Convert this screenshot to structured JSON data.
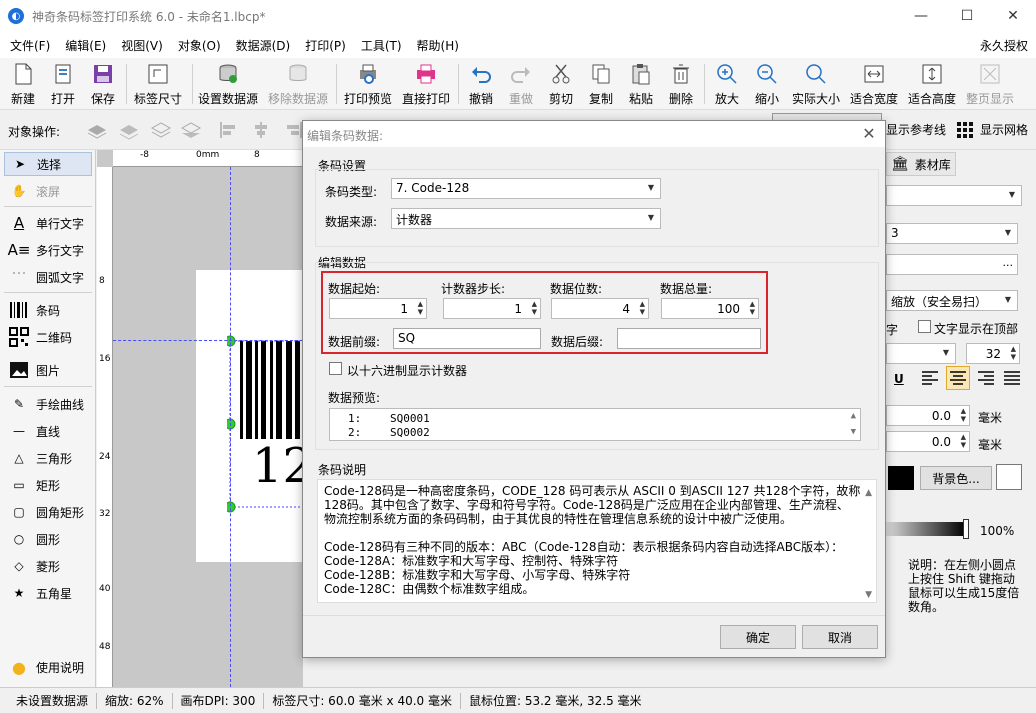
{
  "window": {
    "title": "神奇条码标签打印系统 6.0 - 未命名1.lbcp*"
  },
  "menu": {
    "items": [
      "文件(F)",
      "编辑(E)",
      "视图(V)",
      "对象(O)",
      "数据源(D)",
      "打印(P)",
      "工具(T)",
      "帮助(H)"
    ],
    "right": "永久授权"
  },
  "toolbar": {
    "new": "新建",
    "open": "打开",
    "save": "保存",
    "label_size": "标签尺寸",
    "set_datasource": "设置数据源",
    "remove_datasource": "移除数据源",
    "print_preview": "打印预览",
    "direct_print": "直接打印",
    "undo": "撤销",
    "redo": "重做",
    "cut": "剪切",
    "copy": "复制",
    "paste": "粘贴",
    "delete": "删除",
    "zoom_in": "放大",
    "zoom_out": "缩小",
    "actual_size": "实际大小",
    "fit_width": "适合宽度",
    "fit_height": "适合高度",
    "full_page": "整页显示"
  },
  "objbar": {
    "label": "对象操作:",
    "show_guides": "显示参考线",
    "show_grid": "显示网格"
  },
  "leftpanel": {
    "select": "选择",
    "scroll": "滚屏",
    "single_text": "单行文字",
    "multi_text": "多行文字",
    "arc_text": "圆弧文字",
    "barcode": "条码",
    "qrcode": "二维码",
    "image": "图片",
    "freehand": "手绘曲线",
    "line": "直线",
    "triangle": "三角形",
    "rect": "矩形",
    "round_rect": "圆角矩形",
    "circle": "圆形",
    "diamond": "菱形",
    "star": "五角星",
    "help": "使用说明"
  },
  "canvas": {
    "ruler_top": [
      "-8",
      "0mm",
      "8"
    ],
    "ruler_left": [
      "8",
      "16",
      "24",
      "32",
      "40",
      "48"
    ],
    "barcode_text": "12"
  },
  "rightpanel": {
    "library": "素材库",
    "combo2_partial": "3",
    "ellipsis": "...",
    "scale_mode": "缩放（安全易扫）",
    "text_label": "字",
    "text_on_top": "文字显示在顶部",
    "font_size": "32",
    "underline": "U",
    "offset1": "0.0",
    "offset2": "0.0",
    "unit": "毫米",
    "bg_color": "背景色...",
    "opacity": "100%",
    "note": "说明：在左侧小圆点上按住 Shift 键拖动鼠标可以生成15度倍数角。"
  },
  "dialog": {
    "title": "编辑条码数据:",
    "barcode_settings": "条码设置",
    "barcode_type_label": "条码类型:",
    "barcode_type": "7. Code-128",
    "datasource_label": "数据来源:",
    "datasource": "计数器",
    "edit_data": "编辑数据",
    "start_label": "数据起始:",
    "start": "1",
    "step_label": "计数器步长:",
    "step": "1",
    "digits_label": "数据位数:",
    "digits": "4",
    "total_label": "数据总量:",
    "total": "100",
    "prefix_label": "数据前缀:",
    "prefix": "SQ",
    "suffix_label": "数据后缀:",
    "suffix": "",
    "hex_label": "以十六进制显示计数器",
    "preview_label": "数据预览:",
    "preview": [
      {
        "num": "1:",
        "val": "SQ0001"
      },
      {
        "num": "2:",
        "val": "SQ0002"
      }
    ],
    "desc_title": "条码说明",
    "desc_lines": [
      "Code-128码是一种高密度条码，CODE_128 码可表示从 ASCII 0 到ASCII 127 共128个字符，故称",
      "128码。其中包含了数字、字母和符号字符。Code-128码是广泛应用在企业内部管理、生产流程、",
      "物流控制系统方面的条码码制，由于其优良的特性在管理信息系统的设计中被广泛使用。",
      "",
      "Code-128码有三种不同的版本：ABC（Code-128自动：表示根据条码内容自动选择ABC版本）：",
      "Code-128A：标准数字和大写字母、控制符、特殊字符",
      "Code-128B：标准数字和大写字母、小写字母、特殊字符",
      "Code-128C：由偶数个标准数字组成。"
    ],
    "ok": "确定",
    "cancel": "取消"
  },
  "status": {
    "datasource": "未设置数据源",
    "zoom": "缩放: 62%",
    "dpi": "画布DPI: 300",
    "label_size": "标签尺寸: 60.0 毫米 x 40.0 毫米",
    "mouse": "鼠标位置: 53.2 毫米, 32.5 毫米"
  },
  "colors": {
    "accent": "#1e6fd9",
    "red_highlight": "#d9232d",
    "print_pink": "#e0338a"
  }
}
